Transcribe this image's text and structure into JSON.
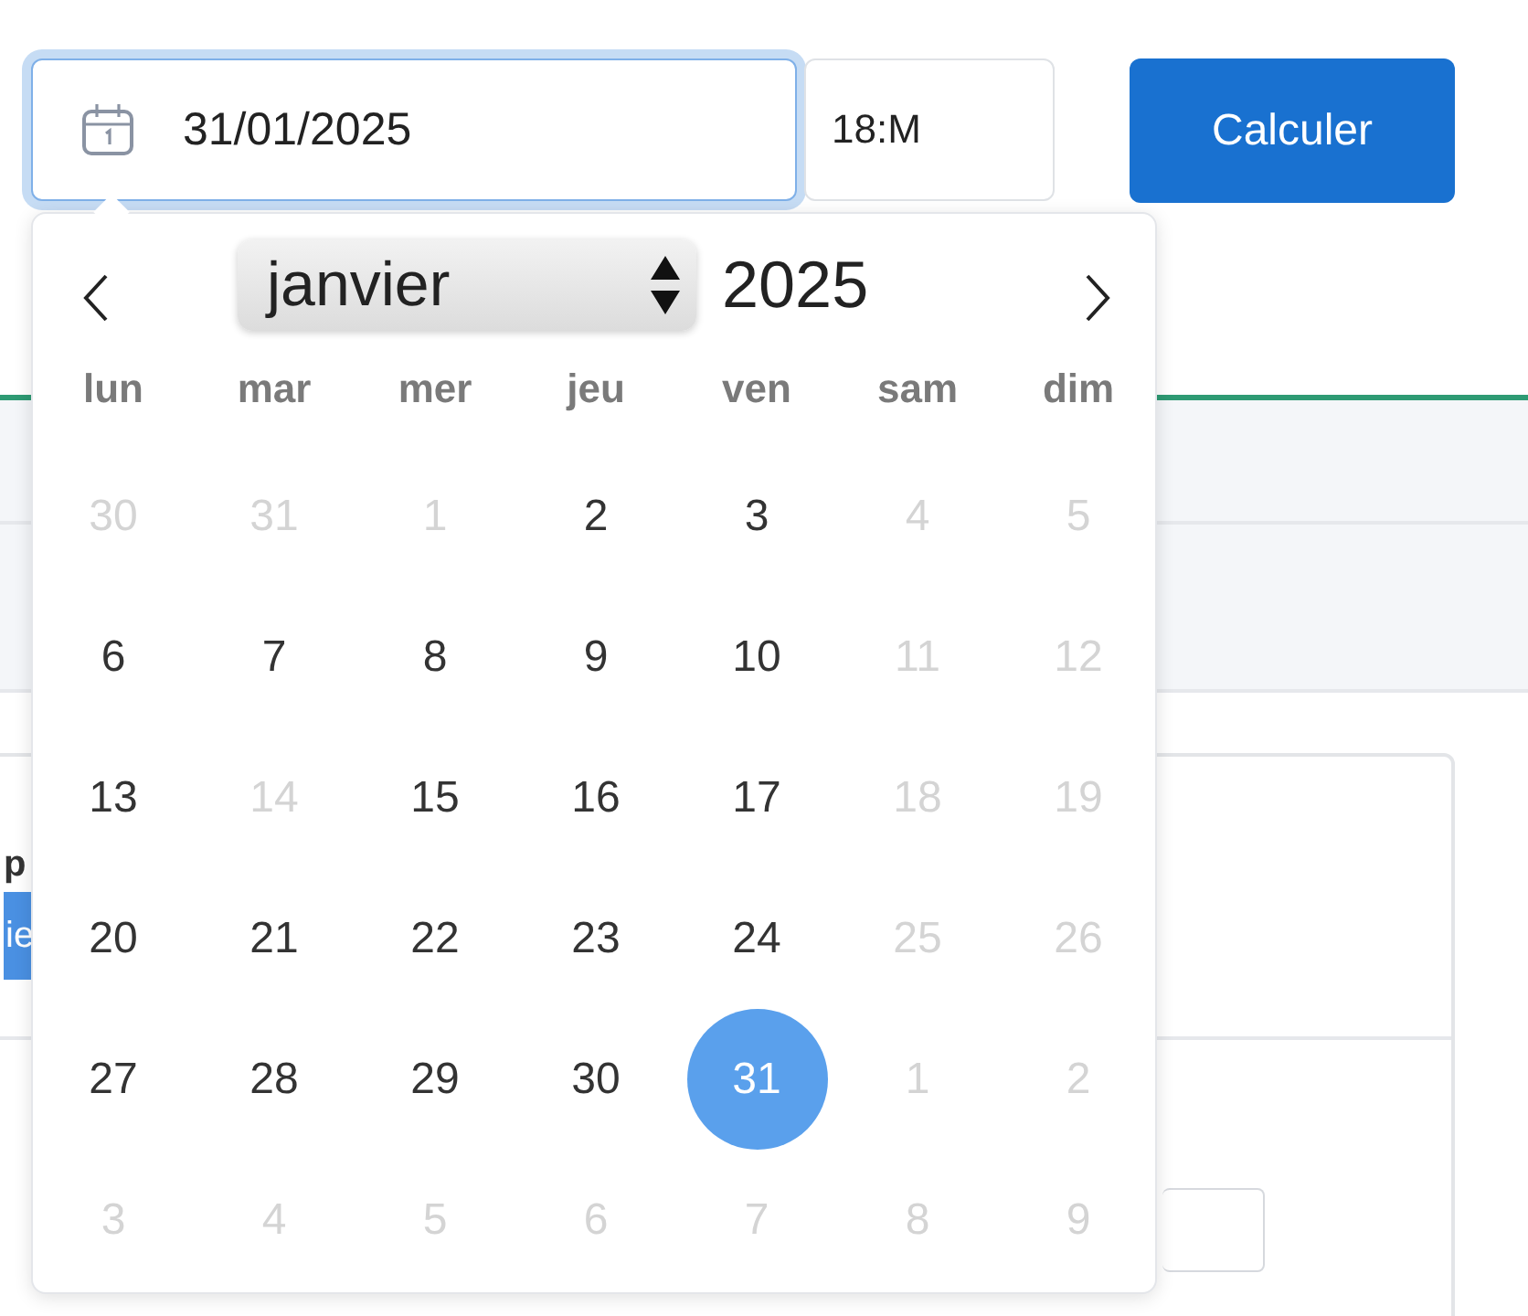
{
  "date_field": {
    "value": "31/01/2025",
    "focused": true
  },
  "time_field": {
    "value": "18:M"
  },
  "calculate_button": {
    "label": "Calculer"
  },
  "card": {
    "label": "p",
    "button": "ie"
  },
  "datepicker": {
    "month": "janvier",
    "year": "2025",
    "weekdays": [
      "lun",
      "mar",
      "mer",
      "jeu",
      "ven",
      "sam",
      "dim"
    ],
    "weeks": [
      [
        {
          "day": "30",
          "disabled": true,
          "selected": false
        },
        {
          "day": "31",
          "disabled": true,
          "selected": false
        },
        {
          "day": "1",
          "disabled": true,
          "selected": false
        },
        {
          "day": "2",
          "disabled": false,
          "selected": false
        },
        {
          "day": "3",
          "disabled": false,
          "selected": false
        },
        {
          "day": "4",
          "disabled": true,
          "selected": false
        },
        {
          "day": "5",
          "disabled": true,
          "selected": false
        }
      ],
      [
        {
          "day": "6",
          "disabled": false,
          "selected": false
        },
        {
          "day": "7",
          "disabled": false,
          "selected": false
        },
        {
          "day": "8",
          "disabled": false,
          "selected": false
        },
        {
          "day": "9",
          "disabled": false,
          "selected": false
        },
        {
          "day": "10",
          "disabled": false,
          "selected": false
        },
        {
          "day": "11",
          "disabled": true,
          "selected": false
        },
        {
          "day": "12",
          "disabled": true,
          "selected": false
        }
      ],
      [
        {
          "day": "13",
          "disabled": false,
          "selected": false
        },
        {
          "day": "14",
          "disabled": true,
          "selected": false
        },
        {
          "day": "15",
          "disabled": false,
          "selected": false
        },
        {
          "day": "16",
          "disabled": false,
          "selected": false
        },
        {
          "day": "17",
          "disabled": false,
          "selected": false
        },
        {
          "day": "18",
          "disabled": true,
          "selected": false
        },
        {
          "day": "19",
          "disabled": true,
          "selected": false
        }
      ],
      [
        {
          "day": "20",
          "disabled": false,
          "selected": false
        },
        {
          "day": "21",
          "disabled": false,
          "selected": false
        },
        {
          "day": "22",
          "disabled": false,
          "selected": false
        },
        {
          "day": "23",
          "disabled": false,
          "selected": false
        },
        {
          "day": "24",
          "disabled": false,
          "selected": false
        },
        {
          "day": "25",
          "disabled": true,
          "selected": false
        },
        {
          "day": "26",
          "disabled": true,
          "selected": false
        }
      ],
      [
        {
          "day": "27",
          "disabled": false,
          "selected": false
        },
        {
          "day": "28",
          "disabled": false,
          "selected": false
        },
        {
          "day": "29",
          "disabled": false,
          "selected": false
        },
        {
          "day": "30",
          "disabled": false,
          "selected": false
        },
        {
          "day": "31",
          "disabled": false,
          "selected": true
        },
        {
          "day": "1",
          "disabled": true,
          "selected": false
        },
        {
          "day": "2",
          "disabled": true,
          "selected": false
        }
      ],
      [
        {
          "day": "3",
          "disabled": true,
          "selected": false
        },
        {
          "day": "4",
          "disabled": true,
          "selected": false
        },
        {
          "day": "5",
          "disabled": true,
          "selected": false
        },
        {
          "day": "6",
          "disabled": true,
          "selected": false
        },
        {
          "day": "7",
          "disabled": true,
          "selected": false
        },
        {
          "day": "8",
          "disabled": true,
          "selected": false
        },
        {
          "day": "9",
          "disabled": true,
          "selected": false
        }
      ]
    ]
  }
}
